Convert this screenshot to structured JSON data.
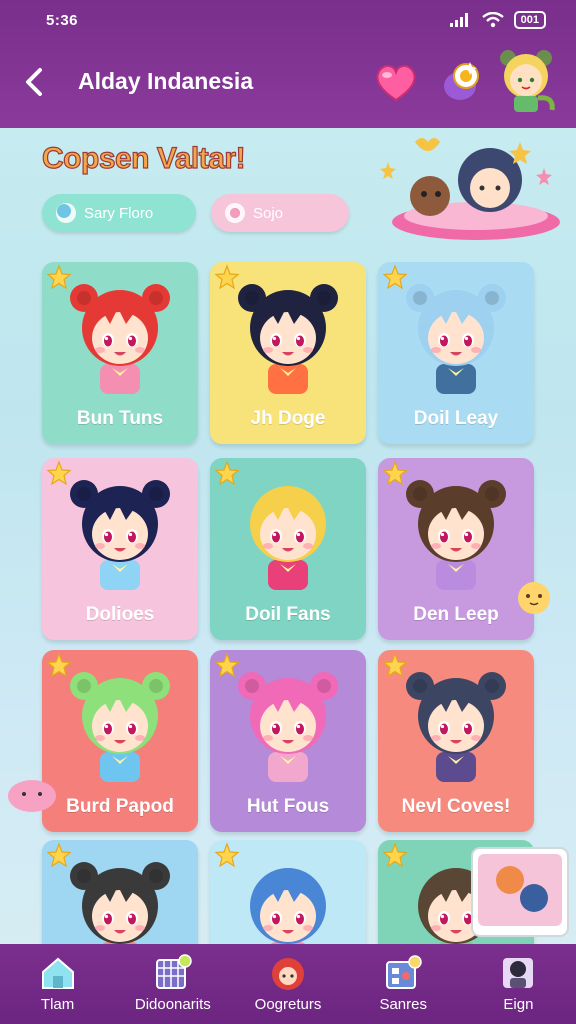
{
  "status": {
    "time": "5:36",
    "battery": "001"
  },
  "header": {
    "title": "Alday Indanesia"
  },
  "section": {
    "title": "Copsen Valtar!"
  },
  "filters": [
    {
      "label": "Sary Floro"
    },
    {
      "label": "Sojo"
    }
  ],
  "characters": [
    {
      "name": "Bun Tuns",
      "bg": "#8fdcc8",
      "hair": "#e53935",
      "ears": true,
      "shirt": "#f48fb1"
    },
    {
      "name": "Jh Doge",
      "bg": "#f8e27a",
      "hair": "#1f2340",
      "ears": true,
      "shirt": "#ff7043"
    },
    {
      "name": "Doil Leay",
      "bg": "#a9dcf2",
      "hair": "#9ed0f0",
      "ears": true,
      "shirt": "#42709e"
    },
    {
      "name": "Dolioes",
      "bg": "#f7c4dd",
      "hair": "#1d2352",
      "ears": true,
      "shirt": "#8fd3f5"
    },
    {
      "name": "Doil Fans",
      "bg": "#7fd4c4",
      "hair": "#f6cf4b",
      "ears": false,
      "shirt": "#e9407a"
    },
    {
      "name": "Den Leep",
      "bg": "#c79ae0",
      "hair": "#5a3e2b",
      "ears": true,
      "shirt": "#b98ce0"
    },
    {
      "name": "Burd Papod",
      "bg": "#f47f7b",
      "hair": "#8ee07a",
      "ears": true,
      "shirt": "#6ec6f0"
    },
    {
      "name": "Hut Fous",
      "bg": "#b48ad9",
      "hair": "#f06ab8",
      "ears": true,
      "shirt": "#f2a8cc"
    },
    {
      "name": "Nevl Coves!",
      "bg": "#f78a7e",
      "hair": "#3c4663",
      "ears": true,
      "shirt": "#5c4b8f"
    },
    {
      "name": "",
      "bg": "#9fd7f3",
      "hair": "#3a3a3a",
      "ears": true,
      "shirt": "#ff8a65"
    },
    {
      "name": "",
      "bg": "#bfe8f7",
      "hair": "#4a86d6",
      "ears": false,
      "shirt": "#f48fb1"
    },
    {
      "name": "",
      "bg": "#7fd4b8",
      "hair": "#5a4634",
      "ears": false,
      "shirt": "#81c784"
    }
  ],
  "nav": [
    {
      "label": "Tlam",
      "icon": "home-icon"
    },
    {
      "label": "Didoonarits",
      "icon": "grid-calendar-icon"
    },
    {
      "label": "Oogreturs",
      "icon": "character-icon"
    },
    {
      "label": "Sanres",
      "icon": "store-icon"
    },
    {
      "label": "Eign",
      "icon": "profile-icon"
    }
  ]
}
